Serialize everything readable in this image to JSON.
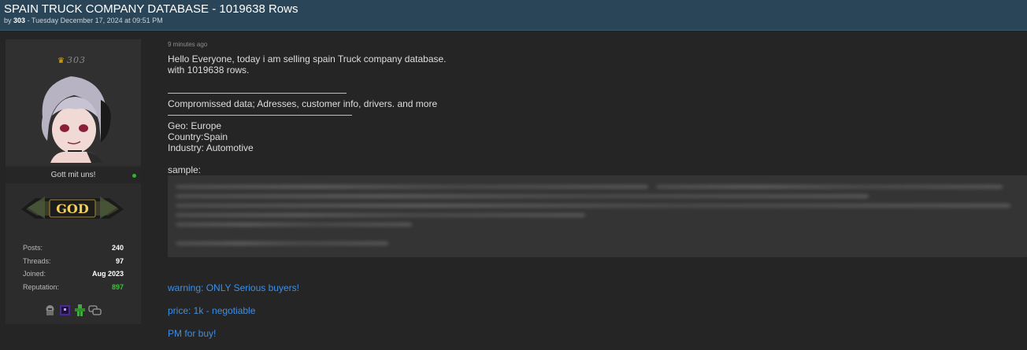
{
  "thread": {
    "title": "SPAIN TRUCK COMPANY DATABASE - 1019638 Rows",
    "by_prefix": "by",
    "author": "303",
    "date": "- Tuesday December 17, 2024 at 09:51 PM"
  },
  "author_card": {
    "username": "303",
    "tagline": "Gott mit uns!",
    "rank_text": "GOD",
    "stats": [
      {
        "label": "Posts:",
        "value": "240"
      },
      {
        "label": "Threads:",
        "value": "97"
      },
      {
        "label": "Joined:",
        "value": "Aug 2023"
      },
      {
        "label": "Reputation:",
        "value": "897"
      }
    ],
    "badges": [
      "helmet-badge",
      "purple-cube-badge",
      "green-figure-badge",
      "chat-bubbles-badge"
    ],
    "colors": {
      "online": "#32b432",
      "reputation": "#3fbf3f",
      "crown": "#f0b400"
    }
  },
  "post": {
    "time_ago": "9 minutes ago",
    "lines": {
      "intro": "Hello Everyone, today i am selling spain Truck company database.",
      "rows": "with 1019638 rows.",
      "compromised": "Compromissed data; Adresses, customer info, drivers. and more",
      "geo": "Geo: Europe",
      "country": "Country:Spain",
      "industry": "Industry: Automotive",
      "sample": "sample:"
    },
    "warning": "warning: ONLY Serious buyers!",
    "price": "price: 1k - negotiable",
    "pm": "PM for buy!",
    "link_color": "#3d8fe6"
  }
}
